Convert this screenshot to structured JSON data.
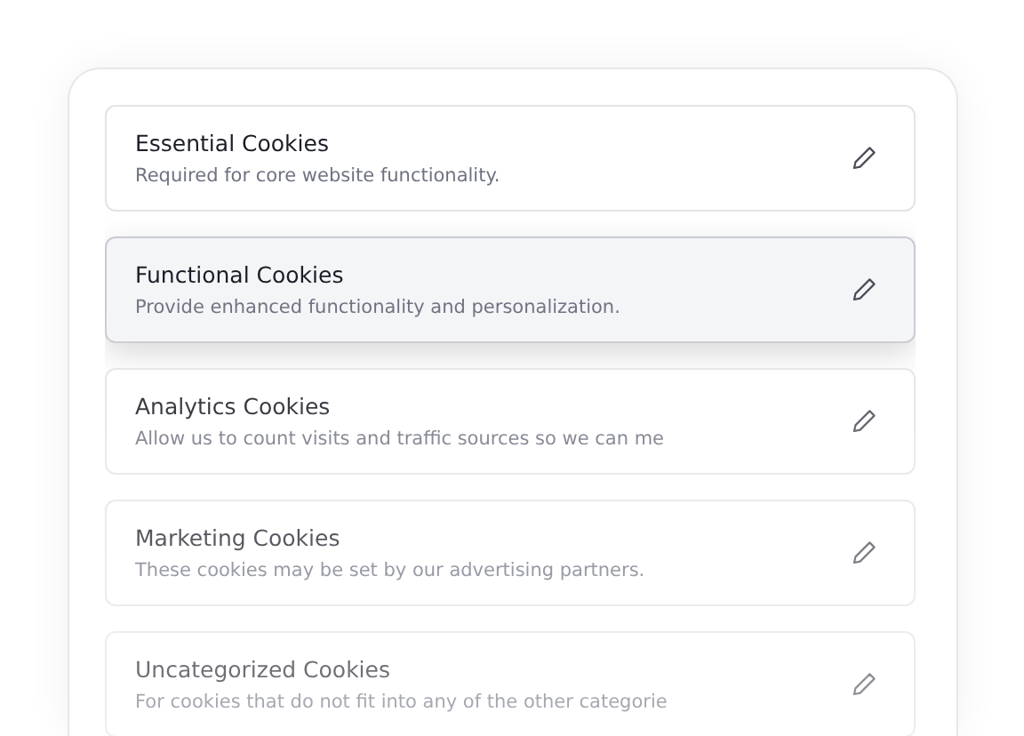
{
  "cookie_categories": [
    {
      "title": "Essential Cookies",
      "description": "Required for core website functionality.",
      "selected": false
    },
    {
      "title": "Functional Cookies",
      "description": "Provide enhanced functionality and personalization.",
      "selected": true
    },
    {
      "title": "Analytics Cookies",
      "description": "Allow us to count visits and traffic sources so we can me",
      "selected": false
    },
    {
      "title": "Marketing Cookies",
      "description": "These cookies may be set by our advertising partners.",
      "selected": false
    },
    {
      "title": "Uncategorized Cookies",
      "description": "For cookies that do not fit into any of the other categorie",
      "selected": false
    }
  ]
}
